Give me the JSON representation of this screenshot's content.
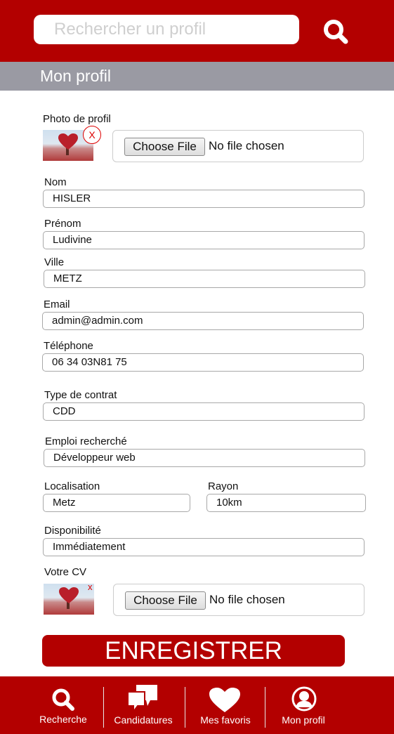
{
  "search": {
    "placeholder": "Rechercher un profil"
  },
  "section": {
    "title": "Mon profil"
  },
  "photo": {
    "label": "Photo de profil",
    "remove": "X",
    "choose_label": "Choose File",
    "status": "No file chosen"
  },
  "form": {
    "nom": {
      "label": "Nom",
      "value": "HISLER"
    },
    "prenom": {
      "label": "Prénom",
      "value": "Ludivine"
    },
    "ville": {
      "label": "Ville",
      "value": "METZ"
    },
    "email": {
      "label": "Email",
      "value": "admin@admin.com"
    },
    "telephone": {
      "label": "Téléphone",
      "value": "06 34 03N81 75"
    },
    "contrat": {
      "label": "Type de contrat",
      "value": "CDD"
    },
    "emploi": {
      "label": "Emploi recherché",
      "value": "Développeur web"
    },
    "localisation": {
      "label": "Localisation",
      "value": "Metz"
    },
    "rayon": {
      "label": "Rayon",
      "value": "10km"
    },
    "disponibilite": {
      "label": "Disponibilité",
      "value": "Immédiatement"
    }
  },
  "cv": {
    "label": "Votre CV",
    "remove": "x",
    "choose_label": "Choose File",
    "status": "No file chosen"
  },
  "save_label": "ENREGISTRER",
  "nav": {
    "recherche": "Recherche",
    "candidatures": "Candidatures",
    "favoris": "Mes favoris",
    "profil": "Mon profil"
  },
  "colors": {
    "brand": "#b30000",
    "section_bar": "#9a9aa3",
    "remove": "#dd0000"
  },
  "icons": {
    "search": "search-icon",
    "candidatures": "speech-bubbles-icon",
    "favoris": "heart-icon",
    "profil": "user-circle-icon"
  }
}
